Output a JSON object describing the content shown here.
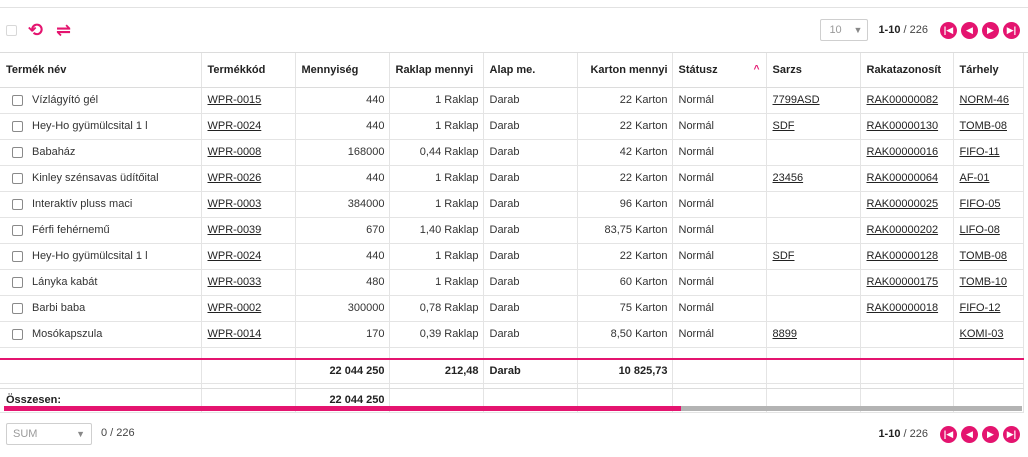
{
  "toolbar": {
    "refresh_icon": "undo-refresh-icon",
    "swap_icon": "swap-arrows-icon",
    "refresh_glyph": "⟲",
    "swap_glyph": "⇌"
  },
  "pagination": {
    "page_size": "10",
    "range": "1-10",
    "separator": " / ",
    "total": "226",
    "first_glyph": "|◀",
    "prev_glyph": "◀",
    "next_glyph": "▶",
    "last_glyph": "▶|"
  },
  "table": {
    "columns": [
      "Termék név",
      "Termékkód",
      "Mennyiség",
      "Raklap mennyi",
      "Alap me.",
      "Karton mennyi",
      "Státusz",
      "Sarzs",
      "Rakatazonosít",
      "Tárhely"
    ],
    "sort_indicator": "^",
    "rows": [
      {
        "name": "Vízlágyító gél",
        "code": "WPR-0015",
        "qty": "440",
        "pallet": "1 Raklap",
        "unit": "Darab",
        "carton": "22 Karton",
        "status": "Normál",
        "batch": "7799ASD",
        "lot": "RAK00000082",
        "location": "NORM-46"
      },
      {
        "name": "Hey-Ho gyümülcsital 1 l",
        "code": "WPR-0024",
        "qty": "440",
        "pallet": "1 Raklap",
        "unit": "Darab",
        "carton": "22 Karton",
        "status": "Normál",
        "batch": "SDF",
        "lot": "RAK00000130",
        "location": "TOMB-08"
      },
      {
        "name": "Babaház",
        "code": "WPR-0008",
        "qty": "168000",
        "pallet": "0,44 Raklap",
        "unit": "Darab",
        "carton": "42 Karton",
        "status": "Normál",
        "batch": "",
        "lot": "RAK00000016",
        "location": "FIFO-11"
      },
      {
        "name": "Kinley szénsavas üdítőital",
        "code": "WPR-0026",
        "qty": "440",
        "pallet": "1 Raklap",
        "unit": "Darab",
        "carton": "22 Karton",
        "status": "Normál",
        "batch": "23456",
        "lot": "RAK00000064",
        "location": "AF-01"
      },
      {
        "name": "Interaktív pluss maci",
        "code": "WPR-0003",
        "qty": "384000",
        "pallet": "1 Raklap",
        "unit": "Darab",
        "carton": "96 Karton",
        "status": "Normál",
        "batch": "",
        "lot": "RAK00000025",
        "location": "FIFO-05"
      },
      {
        "name": "Férfi fehérnemű",
        "code": "WPR-0039",
        "qty": "670",
        "pallet": "1,40 Raklap",
        "unit": "Darab",
        "carton": "83,75 Karton",
        "status": "Normál",
        "batch": "",
        "lot": "RAK00000202",
        "location": "LIFO-08"
      },
      {
        "name": "Hey-Ho gyümülcsital 1 l",
        "code": "WPR-0024",
        "qty": "440",
        "pallet": "1 Raklap",
        "unit": "Darab",
        "carton": "22 Karton",
        "status": "Normál",
        "batch": "SDF",
        "lot": "RAK00000128",
        "location": "TOMB-08"
      },
      {
        "name": "Lányka kabát",
        "code": "WPR-0033",
        "qty": "480",
        "pallet": "1 Raklap",
        "unit": "Darab",
        "carton": "60 Karton",
        "status": "Normál",
        "batch": "",
        "lot": "RAK00000175",
        "location": "TOMB-10"
      },
      {
        "name": "Barbi baba",
        "code": "WPR-0002",
        "qty": "300000",
        "pallet": "0,78 Raklap",
        "unit": "Darab",
        "carton": "75 Karton",
        "status": "Normál",
        "batch": "",
        "lot": "RAK00000018",
        "location": "FIFO-12"
      },
      {
        "name": "Mosókapszula",
        "code": "WPR-0014",
        "qty": "170",
        "pallet": "0,39 Raklap",
        "unit": "Darab",
        "carton": "8,50 Karton",
        "status": "Normál",
        "batch": "8899",
        "lot": "",
        "location": "KOMI-03"
      }
    ],
    "totals": {
      "qty": "22 044 250",
      "pallet": "212,48",
      "unit": "Darab",
      "carton": "10 825,73"
    },
    "summary": {
      "label": "Összesen:",
      "qty": "22 044 250"
    }
  },
  "scrollbar": {
    "position": 0.665
  },
  "footer": {
    "aggregate": "SUM",
    "selected": "0",
    "separator": " / ",
    "total": "226"
  },
  "colors": {
    "accent": "#e4146f"
  }
}
